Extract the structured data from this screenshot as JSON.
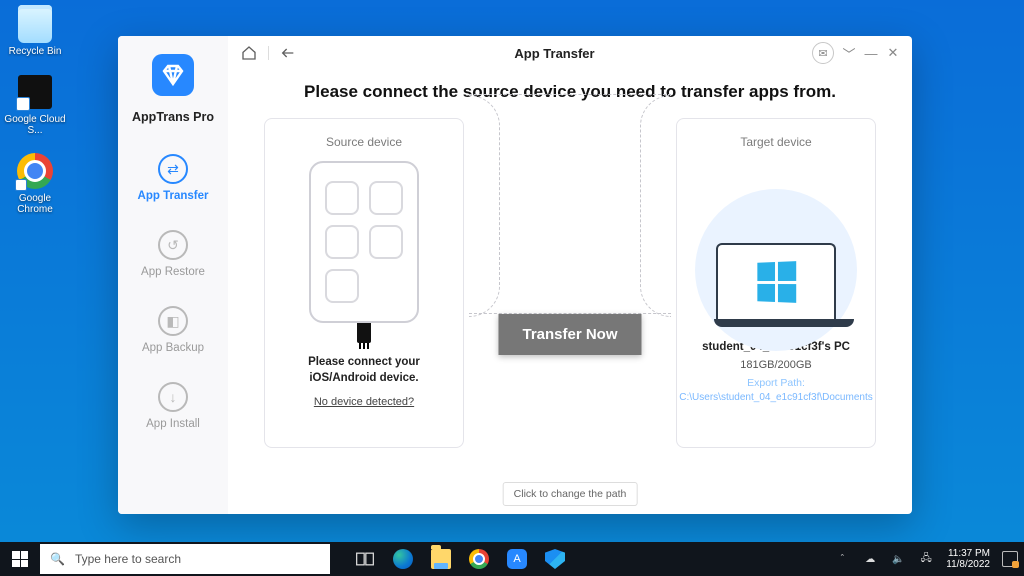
{
  "desktop": {
    "icons": [
      {
        "label": "Recycle Bin"
      },
      {
        "label": "Google Cloud S..."
      },
      {
        "label": "Google Chrome"
      }
    ]
  },
  "app": {
    "brand": "AppTrans Pro",
    "nav": {
      "transfer": "App Transfer",
      "restore": "App Restore",
      "backup": "App Backup",
      "install": "App Install"
    },
    "title": "App Transfer",
    "headline": "Please connect the source device you need to transfer apps from.",
    "source": {
      "title": "Source device",
      "message": "Please connect your iOS/Android device.",
      "link": "No device detected?"
    },
    "target": {
      "title": "Target device",
      "name": "student_04_e1c91cf3f's PC",
      "storage": "181GB/200GB",
      "path_label": "Export Path:",
      "path": "C:\\Users\\student_04_e1c91cf3f\\Documents"
    },
    "transfer_btn": "Transfer Now",
    "path_tooltip": "Click to change the path"
  },
  "taskbar": {
    "search_placeholder": "Type here to search",
    "time": "11:37 PM",
    "date": "11/8/2022",
    "notif_count": "1"
  }
}
